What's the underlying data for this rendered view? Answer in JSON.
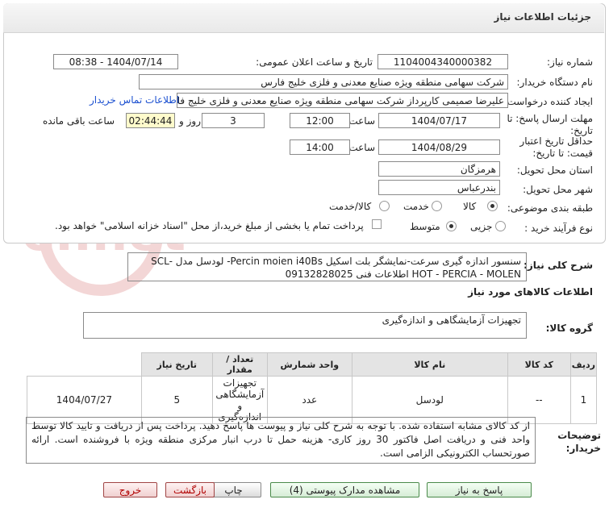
{
  "header": {
    "title": "جزئیات اطلاعات نیاز"
  },
  "fields": {
    "need_number_label": "شماره نیاز:",
    "need_number": "1104004340000382",
    "announce_label": "تاریخ و ساعت اعلان عمومی:",
    "announce_value": "1404/07/14 - 08:38",
    "buyer_label": "نام دستگاه خریدار:",
    "buyer_value": "شرکت سهامی منطقه ویژه صنایع معدنی و فلزی خلیج فارس",
    "creator_label": "ایجاد کننده درخواست:",
    "creator_value": "علیرضا صمیمی کارپرداز شرکت سهامی منطقه ویژه صنایع معدنی و فلزی خلیج فارس",
    "contact_link": "اطلاعات تماس خریدار",
    "deadline_label_1": "مهلت ارسال پاسخ: تا",
    "deadline_label_2": "تاریخ:",
    "deadline_date": "1404/07/17",
    "time_label": "ساعت",
    "deadline_time": "12:00",
    "days_value": "3",
    "days_label": "روز و",
    "remaining_value": "02:44:44",
    "remaining_label": "ساعت باقی مانده",
    "validity_label_1": "حداقل تاریخ اعتبار",
    "validity_label_2": "قیمت: تا تاریخ:",
    "validity_date": "1404/08/29",
    "validity_time": "14:00",
    "province_label": "استان محل تحویل:",
    "province_value": "هرمزگان",
    "city_label": "شهر محل تحویل:",
    "city_value": "بندرعباس",
    "category_label": "طبقه بندی موضوعی:",
    "category_options": [
      "کالا",
      "خدمت",
      "کالا/خدمت"
    ],
    "category_selected": "کالا",
    "process_label": "نوع فرآیند خرید :",
    "process_options": [
      "جزیی",
      "متوسط"
    ],
    "process_selected": "متوسط",
    "payment_note": "پرداخت تمام یا بخشی از مبلغ خرید،از محل \"اسناد خزانه اسلامی\" خواهد بود."
  },
  "description": {
    "label": "شرح کلی نیاز:",
    "text": "سنسور اندازه گیری سرعت-نمایشگر بلت اسکیل Percin moien i40Bs- لودسل مدل SCL- HOT - PERCIA - MOLEN اطلاعات فنی 09132828025"
  },
  "goods_info_title": "اطلاعات کالاهای مورد نیاز",
  "goods_group": {
    "label": "گروه کالا:",
    "value": "تجهیزات آزمایشگاهی و اندازه‌گیری"
  },
  "table": {
    "headers": [
      "ردیف",
      "کد کالا",
      "نام کالا",
      "واحد شمارش",
      "تعداد / مقدار",
      "تاریخ نیاز"
    ],
    "rows": [
      [
        "1",
        "--",
        "لودسل",
        "عدد",
        "5",
        "1404/07/27"
      ]
    ],
    "row_group_lines": [
      "تجهیزات",
      "آزمایشگاهی و",
      "اندازه‌گیری"
    ]
  },
  "buyer_notes": {
    "label": "توضیحات خریدار:",
    "text": "از کد کالای مشابه استفاده شده. با توجه به شرح کلی نیاز و پیوست ها پاسخ دهید. پرداخت پس از دریافت و تایید کالا توسط واحد فنی و دریافت اصل فاکتور 30 روز کاری- هزینه حمل تا درب انبار مرکزی منطقه ویژه با فروشنده است. ارائه صورتحساب الکترونیکی الزامی است."
  },
  "buttons": {
    "reply": "پاسخ به نیاز",
    "attachments": "مشاهده مدارک پیوستی (4)",
    "print": "چاپ",
    "back": "بازگشت",
    "exit": "خروج"
  },
  "watermark": {
    "text": "AriaTender.net"
  },
  "colors": {
    "link": "#1a4fd0",
    "remaining_bg": "#fffbcc",
    "header_bg": "#ececec"
  }
}
